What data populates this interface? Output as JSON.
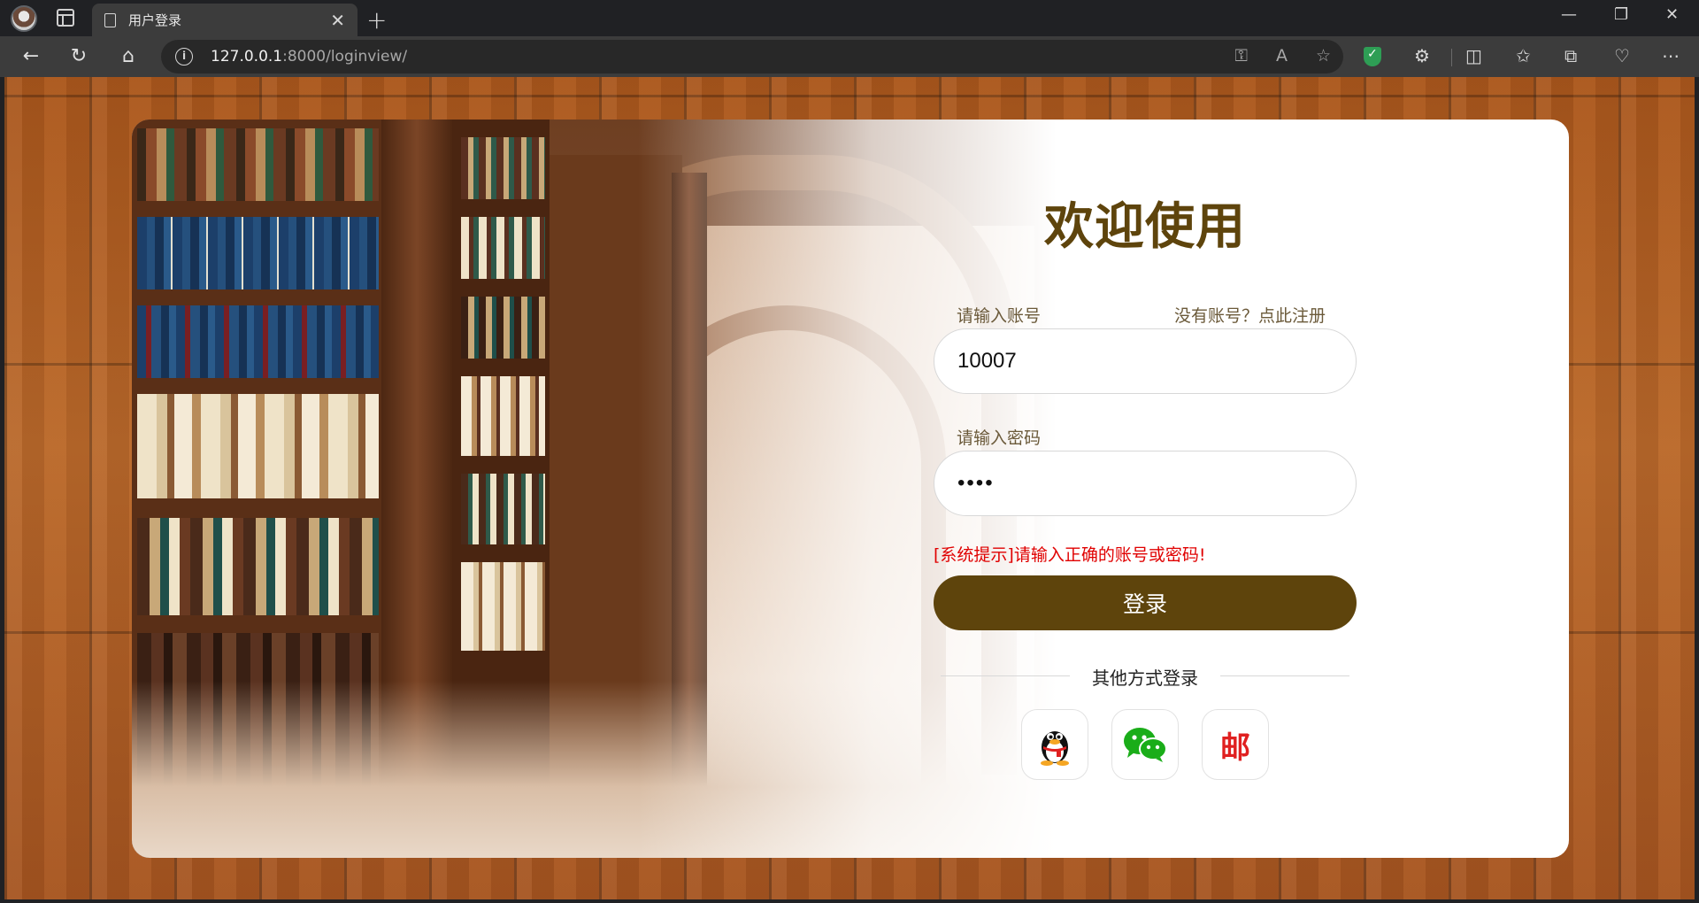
{
  "browser": {
    "tab_title": "用户登录",
    "tab_close": "✕",
    "new_tab": "+",
    "url_host": "127.0.0.1",
    "url_path": ":8000/loginview/",
    "window_controls": {
      "minimize": "—",
      "restore": "❐",
      "close": "✕"
    },
    "toolbar_icons": [
      "back-icon",
      "refresh-icon",
      "home-icon",
      "info-icon",
      "key-icon",
      "read-aloud-icon",
      "favorite-star-icon",
      "shield-icon",
      "extensions-icon",
      "split-screen-icon",
      "favorites-icon",
      "collections-icon",
      "browser-essentials-icon",
      "more-icon"
    ]
  },
  "login": {
    "heading": "欢迎使用",
    "account_label": "请输入账号",
    "register_link": "没有账号？点此注册",
    "account_value": "10007",
    "password_label": "请输入密码",
    "password_value": "••••",
    "error_message": "[系统提示]请输入正确的账号或密码!",
    "login_button": "登录",
    "other_methods": "其他方式登录",
    "social": [
      {
        "name": "qq",
        "icon": "qq-penguin-icon"
      },
      {
        "name": "wechat",
        "icon": "wechat-icon"
      },
      {
        "name": "email",
        "glyph": "邮"
      }
    ]
  },
  "colors": {
    "brand": "#5e440c",
    "error": "#e00000",
    "wechat": "#1aad19",
    "email": "#e02020"
  }
}
